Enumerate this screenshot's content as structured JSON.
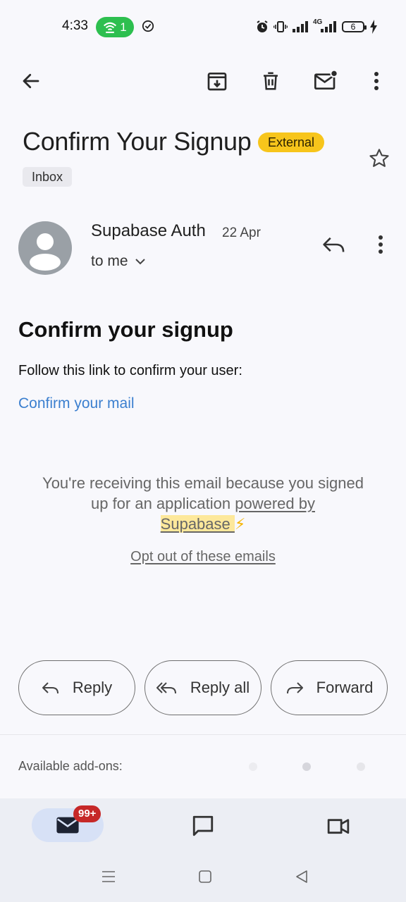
{
  "status_bar": {
    "time": "4:33",
    "wifi_count": "1",
    "battery": "6",
    "network": "4G"
  },
  "toolbar": {
    "icons": [
      "back-arrow-icon",
      "archive-icon",
      "delete-icon",
      "mark-unread-icon",
      "more-vert-icon"
    ]
  },
  "email": {
    "subject": "Confirm Your Signup",
    "external_label": "External",
    "label_chip": "Inbox",
    "sender_name": "Supabase Auth",
    "date": "22 Apr",
    "recipient": "to me",
    "heading": "Confirm your signup",
    "body_line": "Follow this link to confirm your user:",
    "confirm_link": "Confirm your mail",
    "footer_part1": "You're receiving this email because you signed up for an application ",
    "footer_link_a": "powered by ",
    "footer_link_b": "Supabase ",
    "footer_emoji": "⚡",
    "opt_out": "Opt out of these emails"
  },
  "actions": {
    "reply": "Reply",
    "reply_all": "Reply all",
    "forward": "Forward"
  },
  "addons": {
    "label": "Available add-ons:"
  },
  "bottom_nav": {
    "mail_badge": "99+"
  },
  "colors": {
    "accent_link": "#3b7fcf",
    "external_badge": "#f7c51b",
    "wifi_pill": "#2dbf4f",
    "badge_red": "#c62828"
  }
}
